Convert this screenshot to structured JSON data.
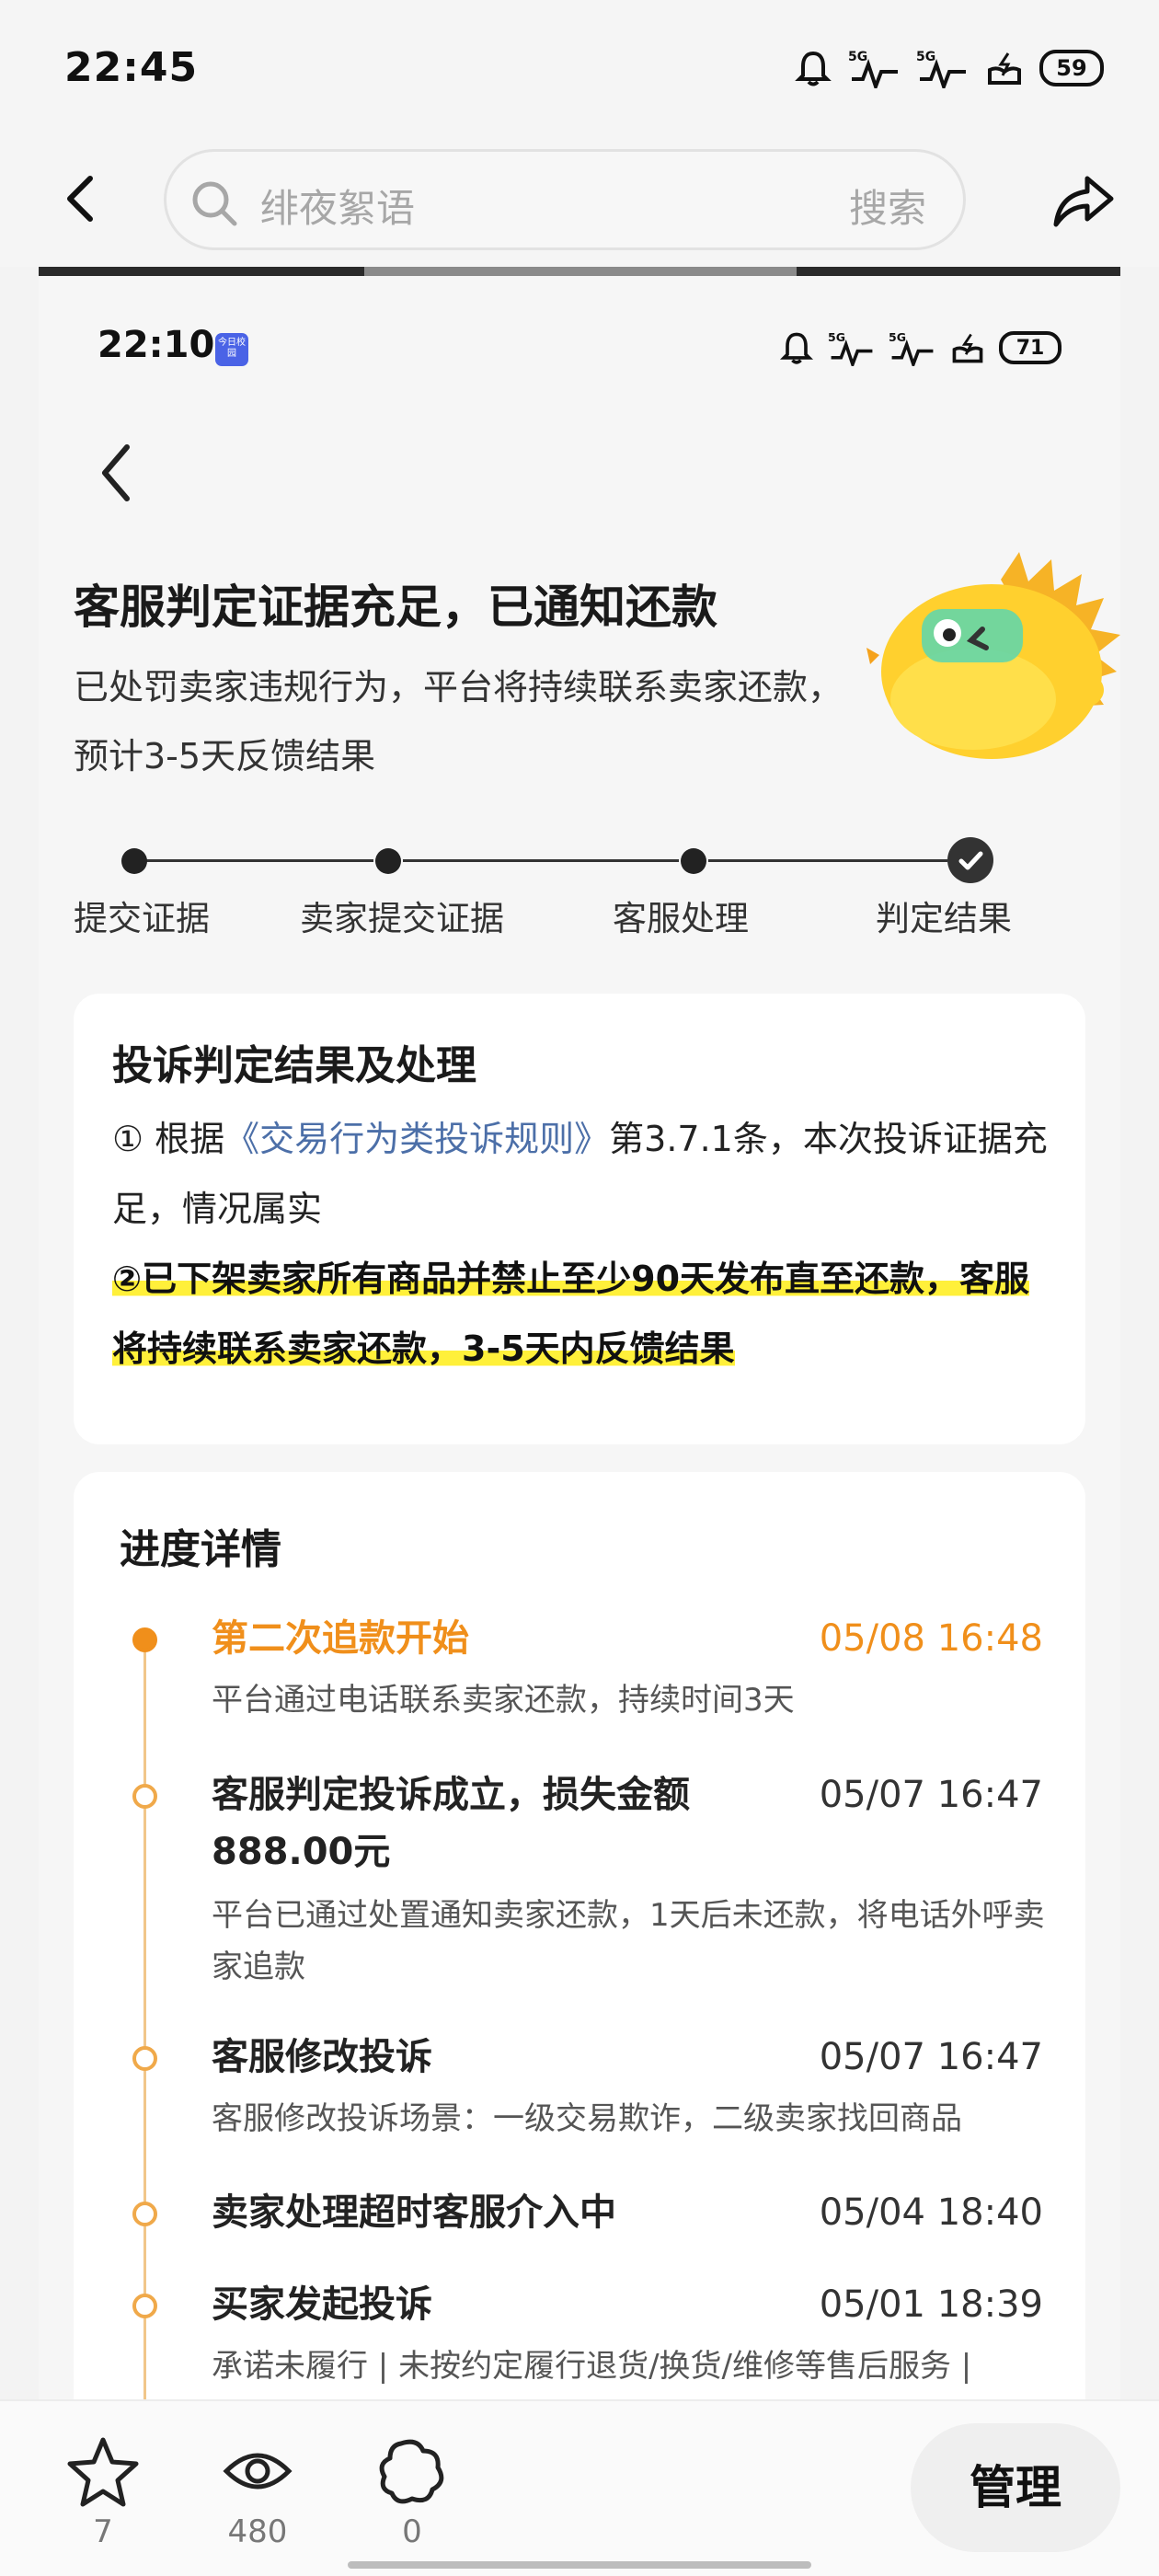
{
  "outer_status": {
    "time": "22:45",
    "battery": "59",
    "net1": "5G",
    "net2": "5G"
  },
  "outer_nav": {
    "search_placeholder": "绯夜絮语",
    "search_button": "搜索"
  },
  "inner_status": {
    "time": "22:10",
    "app_badge": "今日校园",
    "battery": "71",
    "net1": "5G",
    "net2": "5G"
  },
  "page": {
    "title": "客服判定证据充足，已通知还款",
    "subtitle": "已处罚卖家违规行为，平台将持续联系卖家还款，预计3-5天反馈结果"
  },
  "steps": [
    {
      "label": "提交证据"
    },
    {
      "label": "卖家提交证据"
    },
    {
      "label": "客服处理"
    },
    {
      "label": "判定结果"
    }
  ],
  "result_card": {
    "title": "投诉判定结果及处理",
    "line1_prefix": "① 根据",
    "line1_link": "《交易行为类投诉规则》",
    "line1_suffix": "第3.7.1条，本次投诉证据充足，情况属实",
    "line2": "②已下架卖家所有商品并禁止至少90天发布直至还款，客服将持续联系卖家还款，3-5天内反馈结果"
  },
  "progress_card": {
    "title": "进度详情",
    "items": [
      {
        "title": "第二次追款开始",
        "time": "05/08 16:48",
        "desc": "平台通过电话联系卖家还款，持续时间3天",
        "active": true
      },
      {
        "title": "客服判定投诉成立，损失金额888.00元",
        "time": "05/07 16:47",
        "desc": "平台已通过处置通知卖家还款，1天后未还款，将电话外呼卖家追款",
        "active": false
      },
      {
        "title": "客服修改投诉",
        "time": "05/07 16:47",
        "desc": "客服修改投诉场景：一级交易欺诈，二级卖家找回商品",
        "active": false
      },
      {
        "title": "卖家处理超时客服介入中",
        "time": "05/04 18:40",
        "desc": "",
        "active": false
      },
      {
        "title": "买家发起投诉",
        "time": "05/01 18:39",
        "desc": "承诺未履行 | 未按约定履行退货/换货/维修等售后服务 |",
        "active": false
      }
    ]
  },
  "bottom_bar": {
    "favorite_count": "7",
    "view_count": "480",
    "comment_count": "0",
    "manage_label": "管理"
  },
  "colors": {
    "accent_orange": "#f08f1b",
    "link_blue": "#4c6fa8",
    "highlight_yellow": "#fff03a"
  }
}
